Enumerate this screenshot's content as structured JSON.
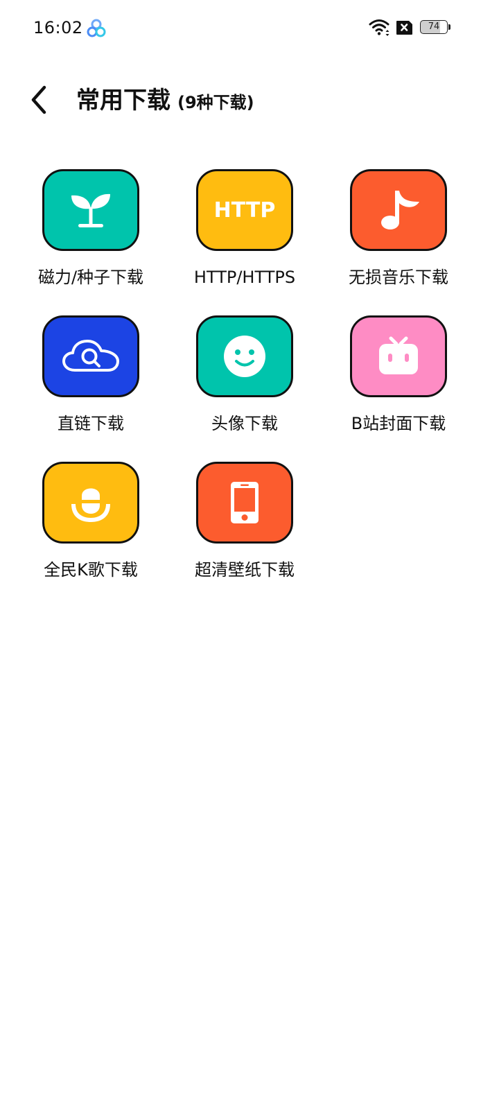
{
  "status_bar": {
    "time": "16:02",
    "battery": "74",
    "battery_level_percent": 74,
    "icons": [
      "app-logo-icon",
      "wifi-icon",
      "sim-blocked-icon",
      "battery-icon"
    ]
  },
  "header": {
    "back_icon": "chevron-left-icon",
    "title": "常用下载",
    "subtitle": "(9种下载)"
  },
  "tiles": [
    {
      "label": "磁力/种子下载",
      "icon": "sprout-icon",
      "color": "#00C4AC"
    },
    {
      "label": "HTTP/HTTPS",
      "icon": "http-text-icon",
      "icon_text": "HTTP",
      "color": "#FFBC10"
    },
    {
      "label": "无损音乐下载",
      "icon": "music-note-icon",
      "color": "#FC5C2E"
    },
    {
      "label": "直链下载",
      "icon": "cloud-search-icon",
      "color": "#1C44E4"
    },
    {
      "label": "头像下载",
      "icon": "smiley-face-icon",
      "color": "#00C4AC"
    },
    {
      "label": "B站封面下载",
      "icon": "bilibili-tv-icon",
      "color": "#FE8CC4"
    },
    {
      "label": "全民K歌下载",
      "icon": "microphone-icon",
      "color": "#FFBC10"
    },
    {
      "label": "超清壁纸下载",
      "icon": "smartphone-icon",
      "color": "#FC5C2E"
    }
  ]
}
